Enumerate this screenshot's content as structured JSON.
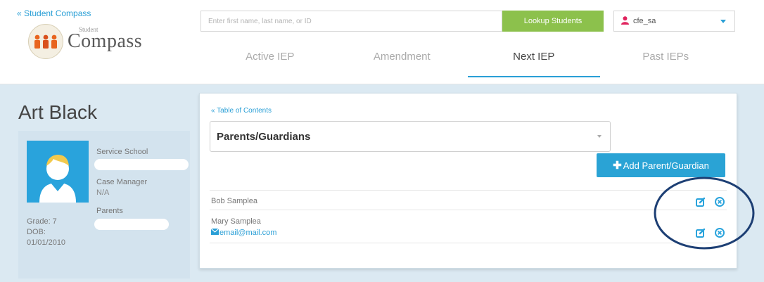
{
  "header": {
    "back_link": "« Student Compass",
    "logo_small": "Student",
    "logo_big": "Compass",
    "search_placeholder": "Enter first name, last name, or ID",
    "lookup_label": "Lookup Students",
    "user_name": "cfe_sa"
  },
  "tabs": [
    {
      "label": "Active IEP",
      "active": false
    },
    {
      "label": "Amendment",
      "active": false
    },
    {
      "label": "Next IEP",
      "active": true
    },
    {
      "label": "Past IEPs",
      "active": false
    }
  ],
  "student": {
    "name": "Art Black",
    "service_school_label": "Service School",
    "case_manager_label": "Case Manager",
    "case_manager_value": "N/A",
    "parents_label": "Parents",
    "grade": "Grade: 7",
    "dob_label": "DOB:",
    "dob_value": "01/01/2010"
  },
  "panel": {
    "toc_link": "« Table of Contents",
    "section_title": "Parents/Guardians",
    "add_button": "Add Parent/Guardian",
    "parents": [
      {
        "name": "Bob Samplea",
        "email": ""
      },
      {
        "name": "Mary Samplea",
        "email": "email@mail.com"
      }
    ]
  },
  "colors": {
    "accent": "#2a9fd6",
    "lookup": "#8cc14c",
    "band": "#dbe9f2",
    "highlight_ellipse": "#1d3f74"
  },
  "icons": [
    "user-icon",
    "edit-icon",
    "delete-icon",
    "mail-icon",
    "avatar-icon",
    "chevron-down-icon"
  ]
}
